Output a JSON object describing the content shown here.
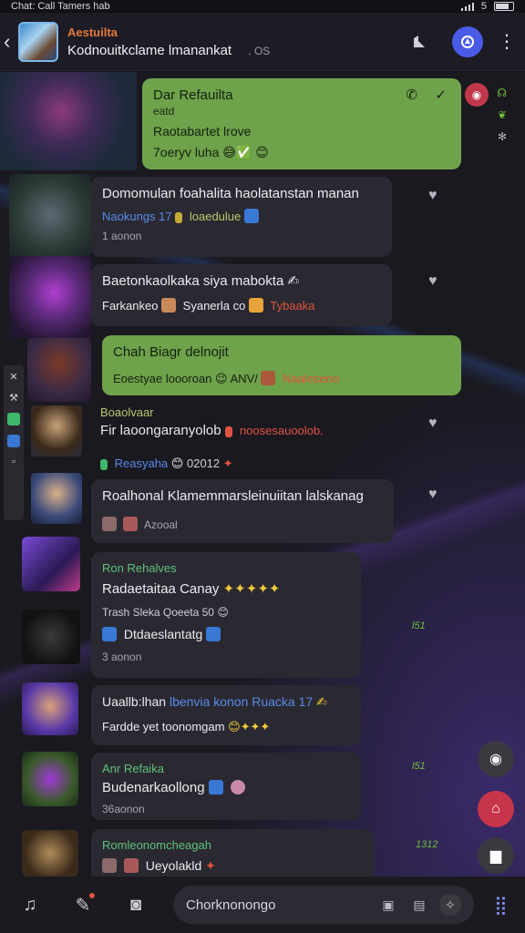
{
  "statusbar": {
    "title": "Chat: Call Tamers hab",
    "right": "5"
  },
  "header": {
    "name": "Aestuilta",
    "subtitle": "Kodnouitkclame lmanankat",
    "subtitle_extra": ". ",
    "subtitle_count": "OS"
  },
  "messages": [
    {
      "type": "out",
      "title": "Dar Refauilta",
      "line2": "eatd",
      "line3": "Raotabartet lrove",
      "line4": "7oeryv luha"
    },
    {
      "type": "in",
      "text": "Domomulan foahalita haolatanstan manan",
      "tag1": "Naokungs 17",
      "tag2": "loaedulue",
      "time": "1 aonon"
    },
    {
      "type": "in",
      "text": "Baetonkaolkaka siya mabokta",
      "tag1": "Farkankeo",
      "tag2": "Syanerla co",
      "tag3": "Tybaaka"
    },
    {
      "type": "out",
      "title": "Chah Biagr delnojit",
      "line2": "Eoestyae loooroan",
      "extra": "ANV/",
      "tag": "Naaleseno"
    },
    {
      "type": "in",
      "sender": "Boaolvaar",
      "text": "Fir laoongaranyolob",
      "tag": "noosesauoolob.",
      "footer": "Reasyaha",
      "footer_time": "02012"
    },
    {
      "type": "in",
      "text": "Roalhonal Klamemmarsleinuiitan lalskanag",
      "sub": "Azooal"
    },
    {
      "type": "in",
      "sender": "Ron Rehalves",
      "text": "Radaetaitaa Canay",
      "line2": "Trash Sleka Qoeeta 50",
      "line3": "Dtdaeslantatg",
      "time": "3 aonon",
      "side_time": "l51"
    },
    {
      "type": "in",
      "text_a": "Uaallb:lhan",
      "text_b": "lbenvia konon Ruacka 17",
      "line2": "Fardde yet",
      "line2b": "toonomgam"
    },
    {
      "type": "in",
      "sender": "Anr Refaika",
      "text": "Budenarkaollong",
      "time": "36aonon",
      "side_time": "l51"
    },
    {
      "type": "in",
      "sender": "Romleonomcheagah",
      "text": "Ueyolakld",
      "side_time": "1312"
    }
  ],
  "bottom": {
    "input_value": "Chorknonongo"
  },
  "icons": [
    "back-arrow-icon",
    "pin-icon",
    "call-icon",
    "menu-icon",
    "phone-icon",
    "check-icon",
    "heart-icon",
    "music-icon",
    "brush-icon",
    "camera-icon",
    "sticker-icon",
    "gallery-icon",
    "gift-icon",
    "apps-grid-icon"
  ],
  "colors": {
    "outgoing_bubble": "#6ea24b",
    "incoming_bubble": "#2a2931",
    "accent_blue": "#4a5be8",
    "sender_green": "#5ec27a",
    "name_orange": "#e27a3c"
  }
}
